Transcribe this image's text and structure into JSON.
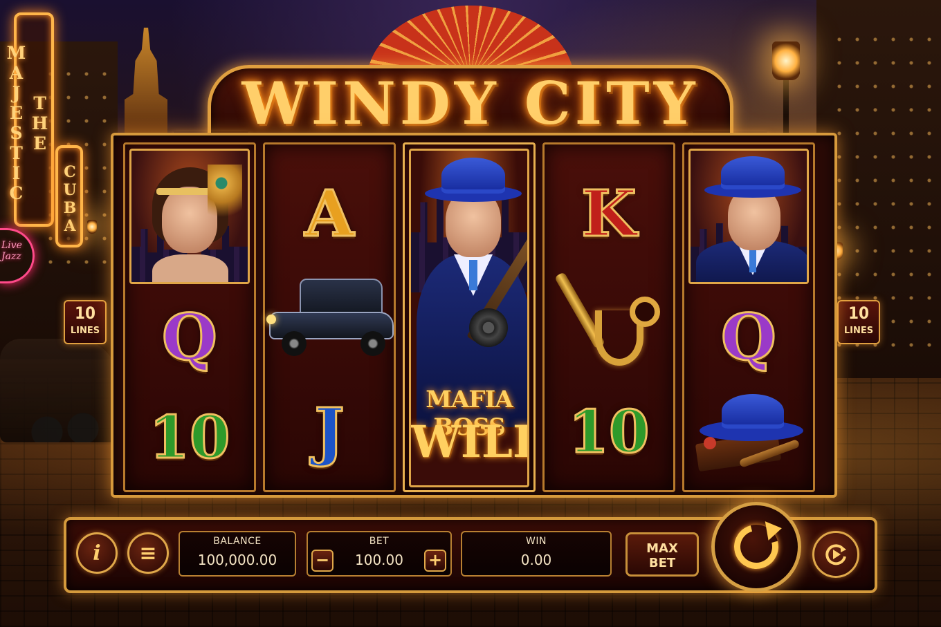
{
  "game": {
    "title": "WINDY CITY"
  },
  "background": {
    "signs": {
      "theater": "THE MAJESTIC",
      "club": "CUBA",
      "neon_heart": "Live Jazz"
    }
  },
  "reels": [
    {
      "symbols": [
        "flapper-girl",
        "Q",
        "10"
      ]
    },
    {
      "symbols": [
        "A",
        "vintage-car",
        "J"
      ]
    },
    {
      "symbols": [
        "mafia-boss-wild"
      ]
    },
    {
      "symbols": [
        "K",
        "saxophone",
        "10"
      ]
    },
    {
      "symbols": [
        "gangster",
        "Q",
        "fedora-hat-cigar"
      ]
    }
  ],
  "symbol_labels": {
    "A": "A",
    "K": "K",
    "Q": "Q",
    "J": "J",
    "ten": "10"
  },
  "wild": {
    "line1": "MAFIA BOSS",
    "line2": "WILD"
  },
  "paylines": {
    "left_count": "10",
    "left_label": "LINES",
    "right_count": "10",
    "right_label": "LINES"
  },
  "controls": {
    "info_label": "i",
    "menu_label": "≡",
    "balance_caption": "BALANCE",
    "balance_value": "100,000.00",
    "bet_caption": "BET",
    "bet_value": "100.00",
    "bet_minus": "−",
    "bet_plus": "+",
    "win_caption": "WIN",
    "win_value": "0.00",
    "max_bet_line1": "MAX",
    "max_bet_line2": "BET"
  },
  "colors": {
    "gold": "#ffcf6a",
    "frame": "#d79a3c",
    "reel_bg": "#4a0f0a",
    "Q": "#9a3ac8",
    "ten": "#2e9a2a",
    "A": "#e8a020",
    "K": "#c0201a",
    "J": "#1c54c8"
  }
}
